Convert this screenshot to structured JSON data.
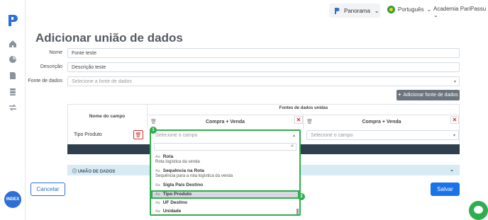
{
  "topbar": {
    "panorama_label": "Panorama",
    "language": "Português",
    "user": "Academia PariPassu"
  },
  "page": {
    "title": "Adicionar união de dados"
  },
  "form": {
    "name_label": "Nome",
    "name_value": "Fonte teste",
    "description_label": "Descrição",
    "description_value": "Descrição teste",
    "source_label": "Fonte de dados",
    "source_placeholder": "Selecione a fonte de dados",
    "add_source_label": "Adicionar fonte de dados"
  },
  "table": {
    "field_name_header": "Nome do campo",
    "sources_header": "Fontes de dados unidas",
    "source_1": "Compra + Venda",
    "source_2": "Compra + Venda",
    "row_field": "Tipo Produto",
    "select_placeholder_1": "Selecione o campo",
    "select_placeholder_2": "Selecione o campo"
  },
  "dropdown": {
    "options": [
      {
        "type": "Aa",
        "name": "Rota",
        "desc": "Rota logística da venda"
      },
      {
        "type": "Aa",
        "name": "Sequência na Rota",
        "desc": "Sequência para a rota logística da venda"
      },
      {
        "type": "Aa",
        "name": "Sigla País Destino",
        "desc": ""
      },
      {
        "type": "Aa",
        "name": "Tipo Produto",
        "desc": ""
      },
      {
        "type": "Aa",
        "name": "UF Destino",
        "desc": ""
      },
      {
        "type": "Aa",
        "name": "Unidade",
        "desc": ""
      }
    ]
  },
  "markers": {
    "one": "1",
    "two": "2"
  },
  "uniao": {
    "label": "UNIÃO DE DADOS"
  },
  "actions": {
    "cancel": "Cancelar",
    "save": "Salvar"
  },
  "sidebar": {
    "index_label_1": "INDEX"
  },
  "colors": {
    "accent": "#1a73e8",
    "highlight": "#2eae4e",
    "danger": "#d9302a"
  }
}
